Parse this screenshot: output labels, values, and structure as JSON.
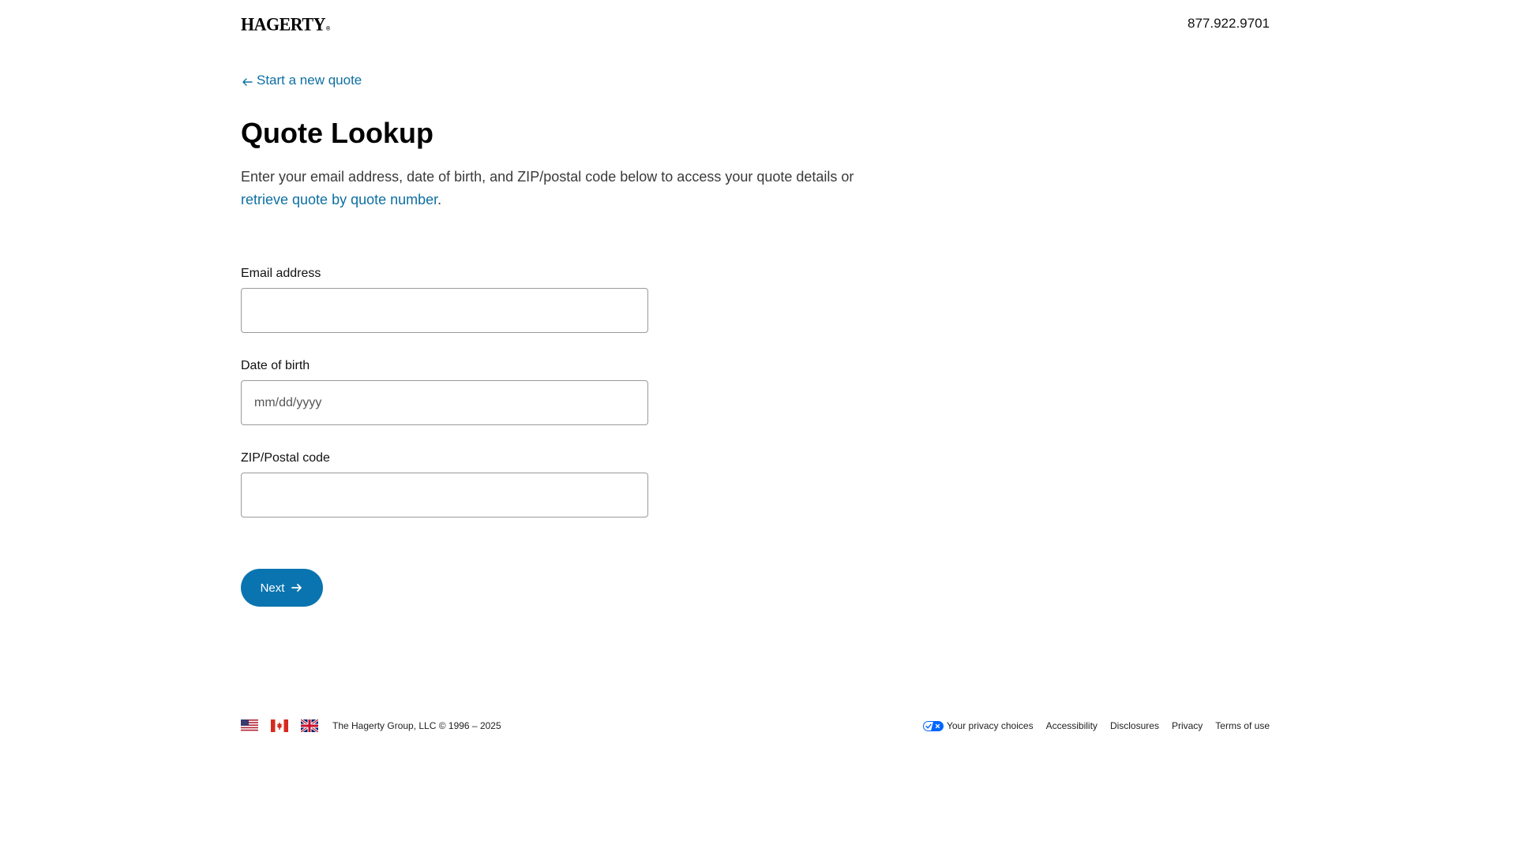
{
  "header": {
    "logo_text": "HAGERTY",
    "logo_mark": "®",
    "phone": "877.922.9701"
  },
  "nav": {
    "back_icon": "arrow-left-icon",
    "back_label": "Start a new quote"
  },
  "main": {
    "title": "Quote Lookup",
    "intro_text": "Enter your email address, date of birth, and ZIP/postal code below to access your quote details or ",
    "intro_link": "retrieve quote by quote number",
    "intro_end": "."
  },
  "form": {
    "email": {
      "label": "Email address",
      "value": "",
      "placeholder": ""
    },
    "dob": {
      "label": "Date of birth",
      "value": "",
      "placeholder": "mm/dd/yyyy"
    },
    "zip": {
      "label": "ZIP/Postal code",
      "value": "",
      "placeholder": ""
    },
    "next_label": "Next",
    "next_icon": "arrow-right-icon"
  },
  "footer": {
    "flags": [
      "us-flag-icon",
      "canada-flag-icon",
      "uk-flag-icon"
    ],
    "copyright": "The Hagerty Group, LLC © 1996 – 2025",
    "privacy_icon": "privacy-choices-icon",
    "links": {
      "privacy_choices": "Your privacy choices",
      "accessibility": "Accessibility",
      "disclosures": "Disclosures",
      "privacy": "Privacy",
      "terms": "Terms of use"
    }
  },
  "colors": {
    "accent": "#0a74b0",
    "link": "#0e6fa3",
    "text": "#111111",
    "muted_text": "#3a3a3a",
    "input_border": "#9a9a9a"
  }
}
